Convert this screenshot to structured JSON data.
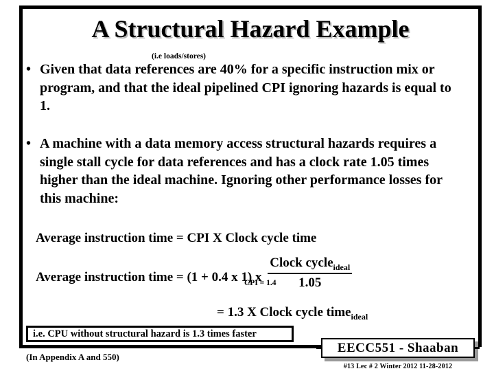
{
  "slide": {
    "title": "A Structural Hazard Example",
    "note_loads_stores": "(i.e loads/stores)",
    "bullets": [
      {
        "marker": "•",
        "text": "Given that data references are  40%  for a specific instruction mix or program,  and that the ideal pipelined CPI ignoring hazards is equal to  1."
      },
      {
        "marker": "•",
        "text": "A machine with a data memory access structural hazards requires a single stall cycle for data references and  has a clock rate 1.05 times higher than the ideal machine. Ignoring other performance losses for this machine:"
      }
    ],
    "equations": {
      "line1": "Average instruction time  =  CPI  X  Clock cycle time",
      "line2_lhs": "Average instruction time  =  (1 +  0.4  x 1)   x",
      "fraction_numerator": "Clock cycle",
      "fraction_numerator_sub": "ideal",
      "fraction_denominator": "1.05",
      "cpi_note": "CPI = 1.4",
      "line3": "=  1.3   X  Clock cycle time",
      "line3_sub": "ideal"
    },
    "conclusion": "i.e.  CPU without structural hazard is 1.3 times faster",
    "appendix_note": "(In  Appendix A and 550)",
    "branding": {
      "course": "EECC551 - Shaaban",
      "meta": "#13   Lec # 2   Winter 2012   11-28-2012"
    }
  }
}
